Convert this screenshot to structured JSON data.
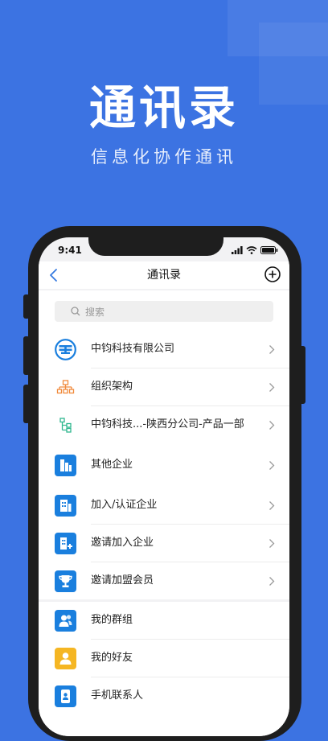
{
  "promo": {
    "headline": "通讯录",
    "subline": "信息化协作通讯"
  },
  "status_bar": {
    "time": "9:41"
  },
  "navbar": {
    "title": "通讯录"
  },
  "search": {
    "placeholder": "搜索"
  },
  "groups": [
    {
      "rows": [
        {
          "label": "中钧科技有限公司",
          "icon": "company-logo-icon"
        },
        {
          "label": "组织架构",
          "icon": "org-structure-icon"
        },
        {
          "label": "中钧科技...-陕西分公司-产品一部",
          "icon": "department-tree-icon"
        }
      ]
    },
    {
      "rows": [
        {
          "label": "其他企业",
          "icon": "buildings-icon"
        }
      ]
    },
    {
      "rows": [
        {
          "label": "加入/认证企业",
          "icon": "join-enterprise-icon"
        },
        {
          "label": "邀请加入企业",
          "icon": "invite-enterprise-icon"
        },
        {
          "label": "邀请加盟会员",
          "icon": "trophy-icon"
        }
      ]
    },
    {
      "rows": [
        {
          "label": "我的群组",
          "icon": "group-icon"
        },
        {
          "label": "我的好友",
          "icon": "friend-icon"
        },
        {
          "label": "手机联系人",
          "icon": "phone-contacts-icon"
        }
      ]
    }
  ],
  "colors": {
    "background": "#3c73e2",
    "icon_blue": "#1a7fde",
    "icon_yellow": "#f5b623",
    "org_orange": "#f08a3c",
    "tree_green": "#2fb78e",
    "back_arrow": "#3579e0"
  }
}
